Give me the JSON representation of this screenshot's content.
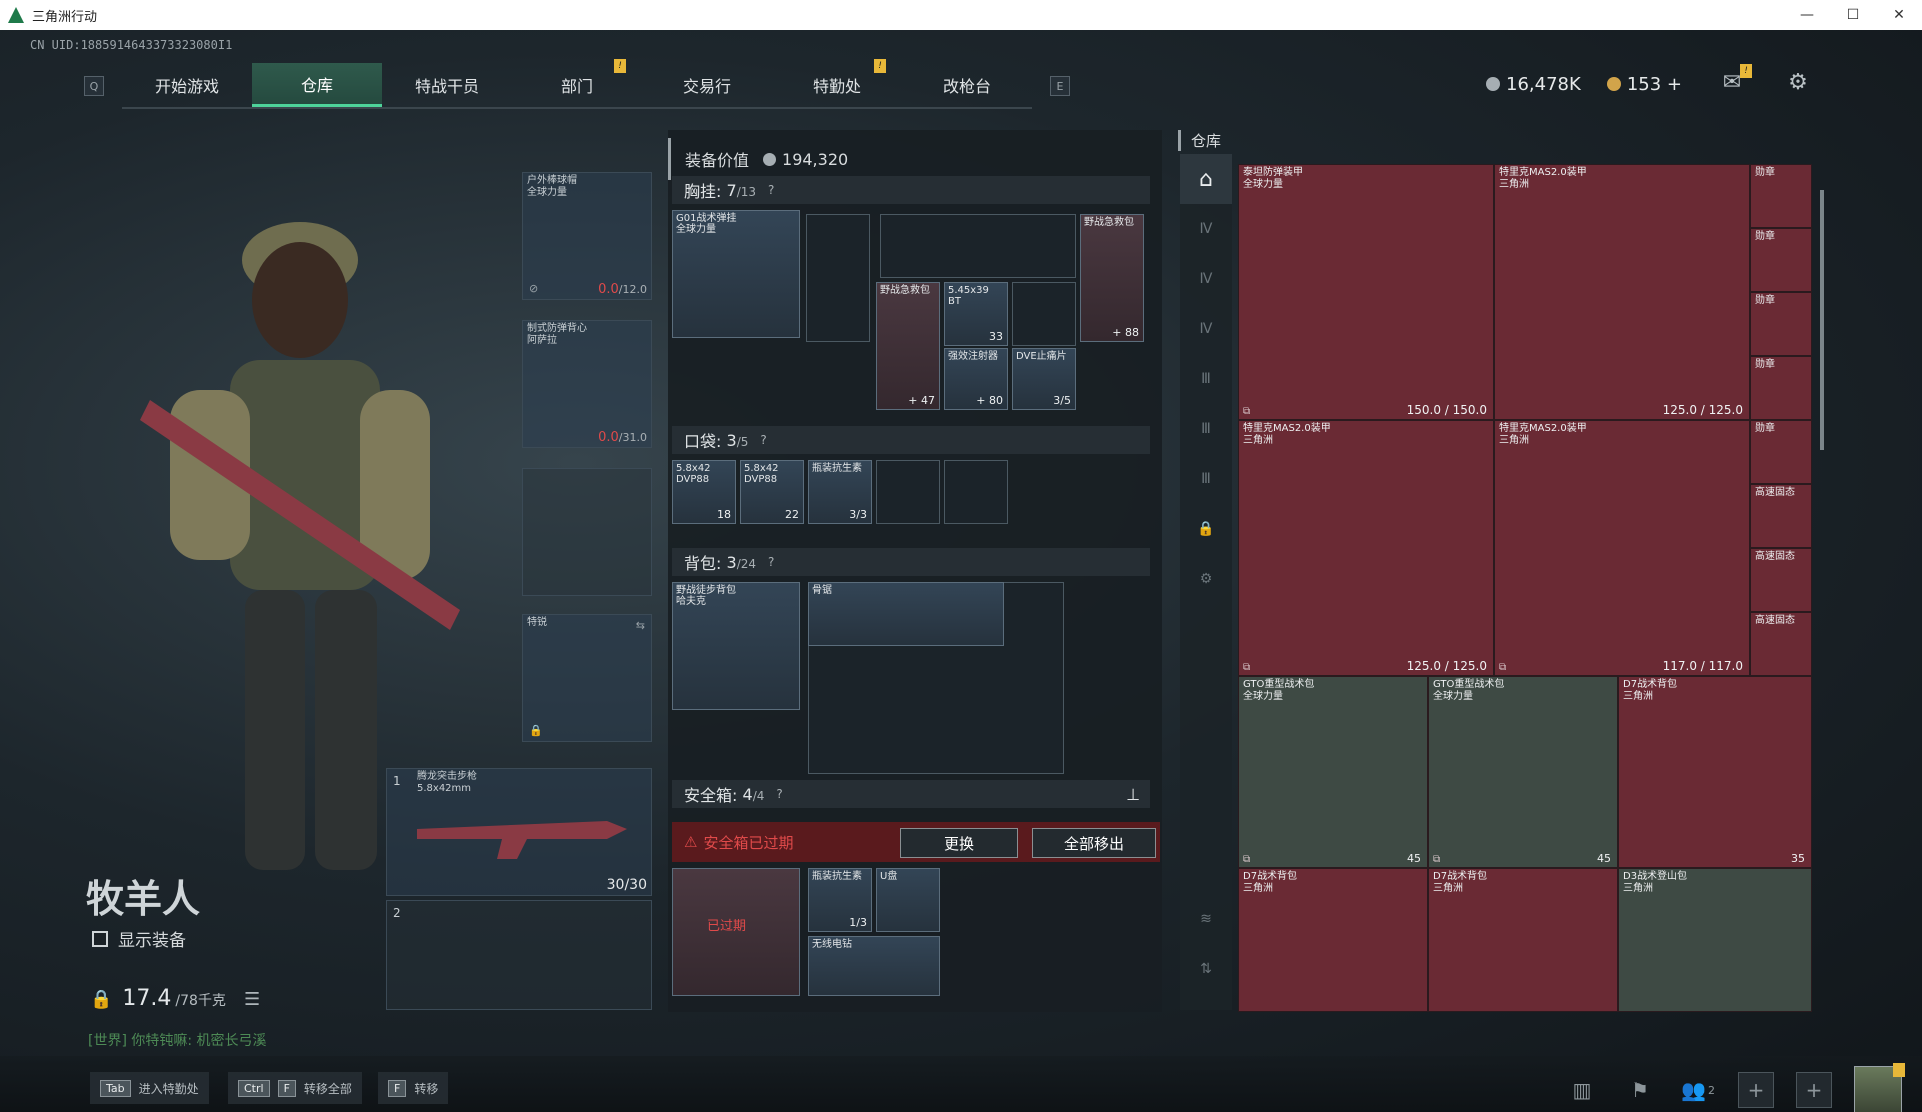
{
  "window": {
    "title": "三角洲行动",
    "minimize": "—",
    "maximize": "☐",
    "close": "✕"
  },
  "uid": "CN UID:1885914643373323080I1",
  "nav": {
    "left_key": "Q",
    "right_key": "E",
    "tabs": [
      {
        "label": "开始游戏",
        "active": false,
        "badge": false
      },
      {
        "label": "仓库",
        "active": true,
        "badge": false
      },
      {
        "label": "特战干员",
        "active": false,
        "badge": false
      },
      {
        "label": "部门",
        "active": false,
        "badge": true
      },
      {
        "label": "交易行",
        "active": false,
        "badge": false
      },
      {
        "label": "特勤处",
        "active": false,
        "badge": true
      },
      {
        "label": "改枪台",
        "active": false,
        "badge": false
      }
    ],
    "badge_text": "!"
  },
  "currency": {
    "silver": "16,478K",
    "gold": "153 +"
  },
  "character": {
    "name": "牧羊人",
    "show_equipment": "显示装备",
    "weight": "17.4",
    "weight_max": "/78千克",
    "world_chat": "[世界] 你特钝嘛: 机密长弓溪"
  },
  "equip_slots": {
    "helmet": {
      "label": "户外棒球帽\n全球力量",
      "durability": "0.0",
      "durability_max": "/12.0"
    },
    "armor": {
      "label": "制式防弹背心\n阿萨拉",
      "durability": "0.0",
      "durability_max": "/31.0"
    },
    "melee": {
      "label": "特锐"
    },
    "primary": {
      "index": "1",
      "label": "腾龙突击步枪",
      "ammo_type": "5.8x42mm",
      "ammo": "30/30"
    },
    "secondary": {
      "index": "2"
    }
  },
  "inventory": {
    "equip_value_label": "装备价值",
    "equip_value": "194,320",
    "rig": {
      "label": "胸挂:",
      "count": "7",
      "max": "/13",
      "help": "?"
    },
    "rig_item": {
      "label": "G01战术弹挂\n全球力量"
    },
    "rig_items": [
      {
        "label": "野战急救包",
        "qty": "+ 47"
      },
      {
        "label": "5.45x39\nBT",
        "qty": "33"
      },
      {
        "label": "强效注射器",
        "qty": "+ 80"
      },
      {
        "label": "DVE止痛片",
        "qty": "3/5"
      },
      {
        "label": "野战急救包",
        "qty": "+ 88"
      }
    ],
    "pocket": {
      "label": "口袋:",
      "count": "3",
      "max": "/5",
      "help": "?"
    },
    "pocket_items": [
      {
        "label": "5.8x42\nDVP88",
        "qty": "18"
      },
      {
        "label": "5.8x42\nDVP88",
        "qty": "22"
      },
      {
        "label": "瓶装抗生素",
        "qty": "3/3"
      }
    ],
    "backpack": {
      "label": "背包:",
      "count": "3",
      "max": "/24",
      "help": "?"
    },
    "backpack_item": {
      "label": "野战徒步背包\n哈夫克"
    },
    "backpack_items": [
      {
        "label": "骨锯"
      }
    ],
    "safe": {
      "label": "安全箱:",
      "count": "4",
      "max": "/4",
      "help": "?",
      "pin": "⊥"
    },
    "safe_expired": "安全箱已过期",
    "safe_replace": "更换",
    "safe_move_all": "全部移出",
    "safe_box_label": "已过期",
    "safe_items": [
      {
        "label": "瓶装抗生素",
        "qty": "1/3"
      },
      {
        "label": "U盘",
        "qty": ""
      },
      {
        "label": "无线电钻",
        "qty": ""
      }
    ]
  },
  "warehouse": {
    "title": "仓库",
    "items": [
      {
        "label": "泰坦防弹装甲\n全球力量",
        "dur": "150.0 / 150.0"
      },
      {
        "label": "特里克MAS2.0装甲\n三角洲",
        "dur": "125.0 / 125.0"
      },
      {
        "label": "特里克MAS2.0装甲\n三角洲",
        "dur": "125.0 / 125.0"
      },
      {
        "label": "特里克MAS2.0装甲\n三角洲",
        "dur": "117.0 / 117.0"
      },
      {
        "label": "GTO重型战术包\n全球力量",
        "dur": "45"
      },
      {
        "label": "GTO重型战术包\n全球力量",
        "dur": "45"
      },
      {
        "label": "D7战术背包\n三角洲",
        "dur": "35"
      },
      {
        "label": "D7战术背包\n三角洲",
        "dur": ""
      },
      {
        "label": "D7战术背包\n三角洲",
        "dur": ""
      },
      {
        "label": "D3战术登山包\n三角洲",
        "dur": ""
      }
    ],
    "small_items": [
      {
        "label": "勋章"
      },
      {
        "label": "勋章"
      },
      {
        "label": "勋章"
      },
      {
        "label": "勋章"
      },
      {
        "label": "勋章"
      },
      {
        "label": "高速固态"
      },
      {
        "label": "高速固态"
      },
      {
        "label": "高速固态"
      }
    ]
  },
  "bottom": {
    "hints": [
      {
        "keys": [
          "Tab"
        ],
        "label": "进入特勤处"
      },
      {
        "keys": [
          "Ctrl",
          "F"
        ],
        "label": "转移全部"
      },
      {
        "keys": [
          "F"
        ],
        "label": "转移"
      }
    ],
    "friends_count": "2"
  }
}
